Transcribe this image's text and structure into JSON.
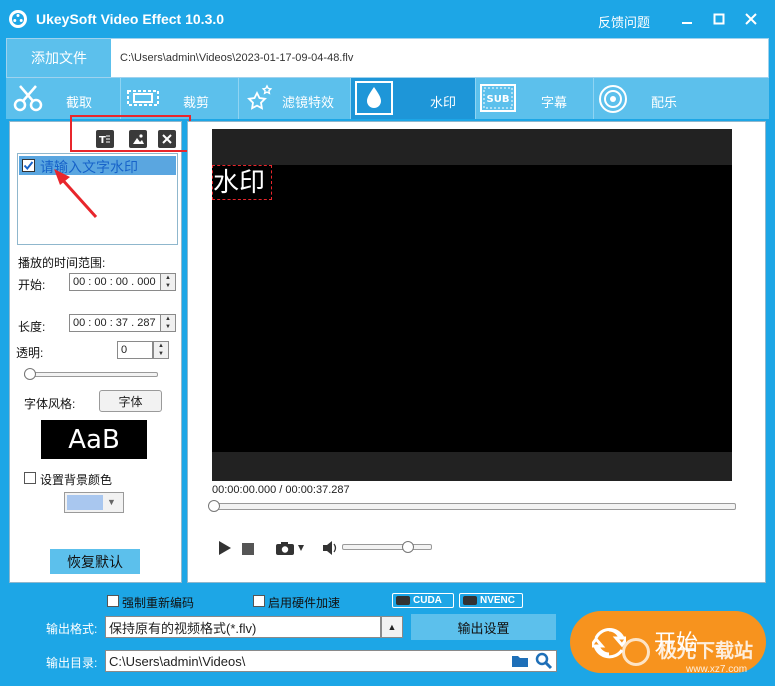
{
  "app": {
    "title": "UkeySoft Video Effect 10.3.0",
    "feedback": "反馈问题"
  },
  "toolbar": {
    "add_file": "添加文件",
    "file_path": "C:\\Users\\admin\\Videos\\2023-01-17-09-04-48.flv"
  },
  "tabs": [
    {
      "label": "截取",
      "icon": "scissors-icon"
    },
    {
      "label": "裁剪",
      "icon": "crop-icon"
    },
    {
      "label": "滤镜特效",
      "icon": "stars-icon"
    },
    {
      "label": "水印",
      "icon": "droplet-icon"
    },
    {
      "label": "字幕",
      "icon": "subtitle-icon"
    },
    {
      "label": "配乐",
      "icon": "music-icon"
    }
  ],
  "active_tab": "水印",
  "watermark": {
    "item_text": "请输入文字水印",
    "item_checked": true,
    "time_range_label": "播放的时间范围:",
    "start_label": "开始:",
    "start_value": "00 : 00 : 00 . 000",
    "length_label": "长度:",
    "length_value": "00 : 00 : 37 . 287",
    "opacity_label": "透明:",
    "opacity_value": "0",
    "font_style_label": "字体风格:",
    "font_button": "字体",
    "font_preview": "AaB",
    "bg_color_label": "设置背景颜色",
    "bg_color_checked": false,
    "restore_button": "恢复默认"
  },
  "preview": {
    "overlay_text": "水印",
    "time": "00:00:00.000 / 00:00:37.287"
  },
  "bottom": {
    "reencode_label": "强制重新编码",
    "hw_accel_label": "启用硬件加速",
    "cuda": "CUDA",
    "nvenc": "NVENC",
    "format_label": "输出格式:",
    "format_value": "保持原有的视频格式(*.flv)",
    "output_settings": "输出设置",
    "dir_label": "输出目录:",
    "dir_value": "C:\\Users\\admin\\Videos\\",
    "start_button": "开始",
    "watermark_logo": "极光下载站",
    "watermark_url": "www.xz7.com"
  },
  "colors": {
    "accent": "#1da6e6",
    "tab": "#5cc0ec",
    "tab_active": "#1e96d8",
    "highlight": "#e8262c",
    "start": "#f7931e"
  }
}
